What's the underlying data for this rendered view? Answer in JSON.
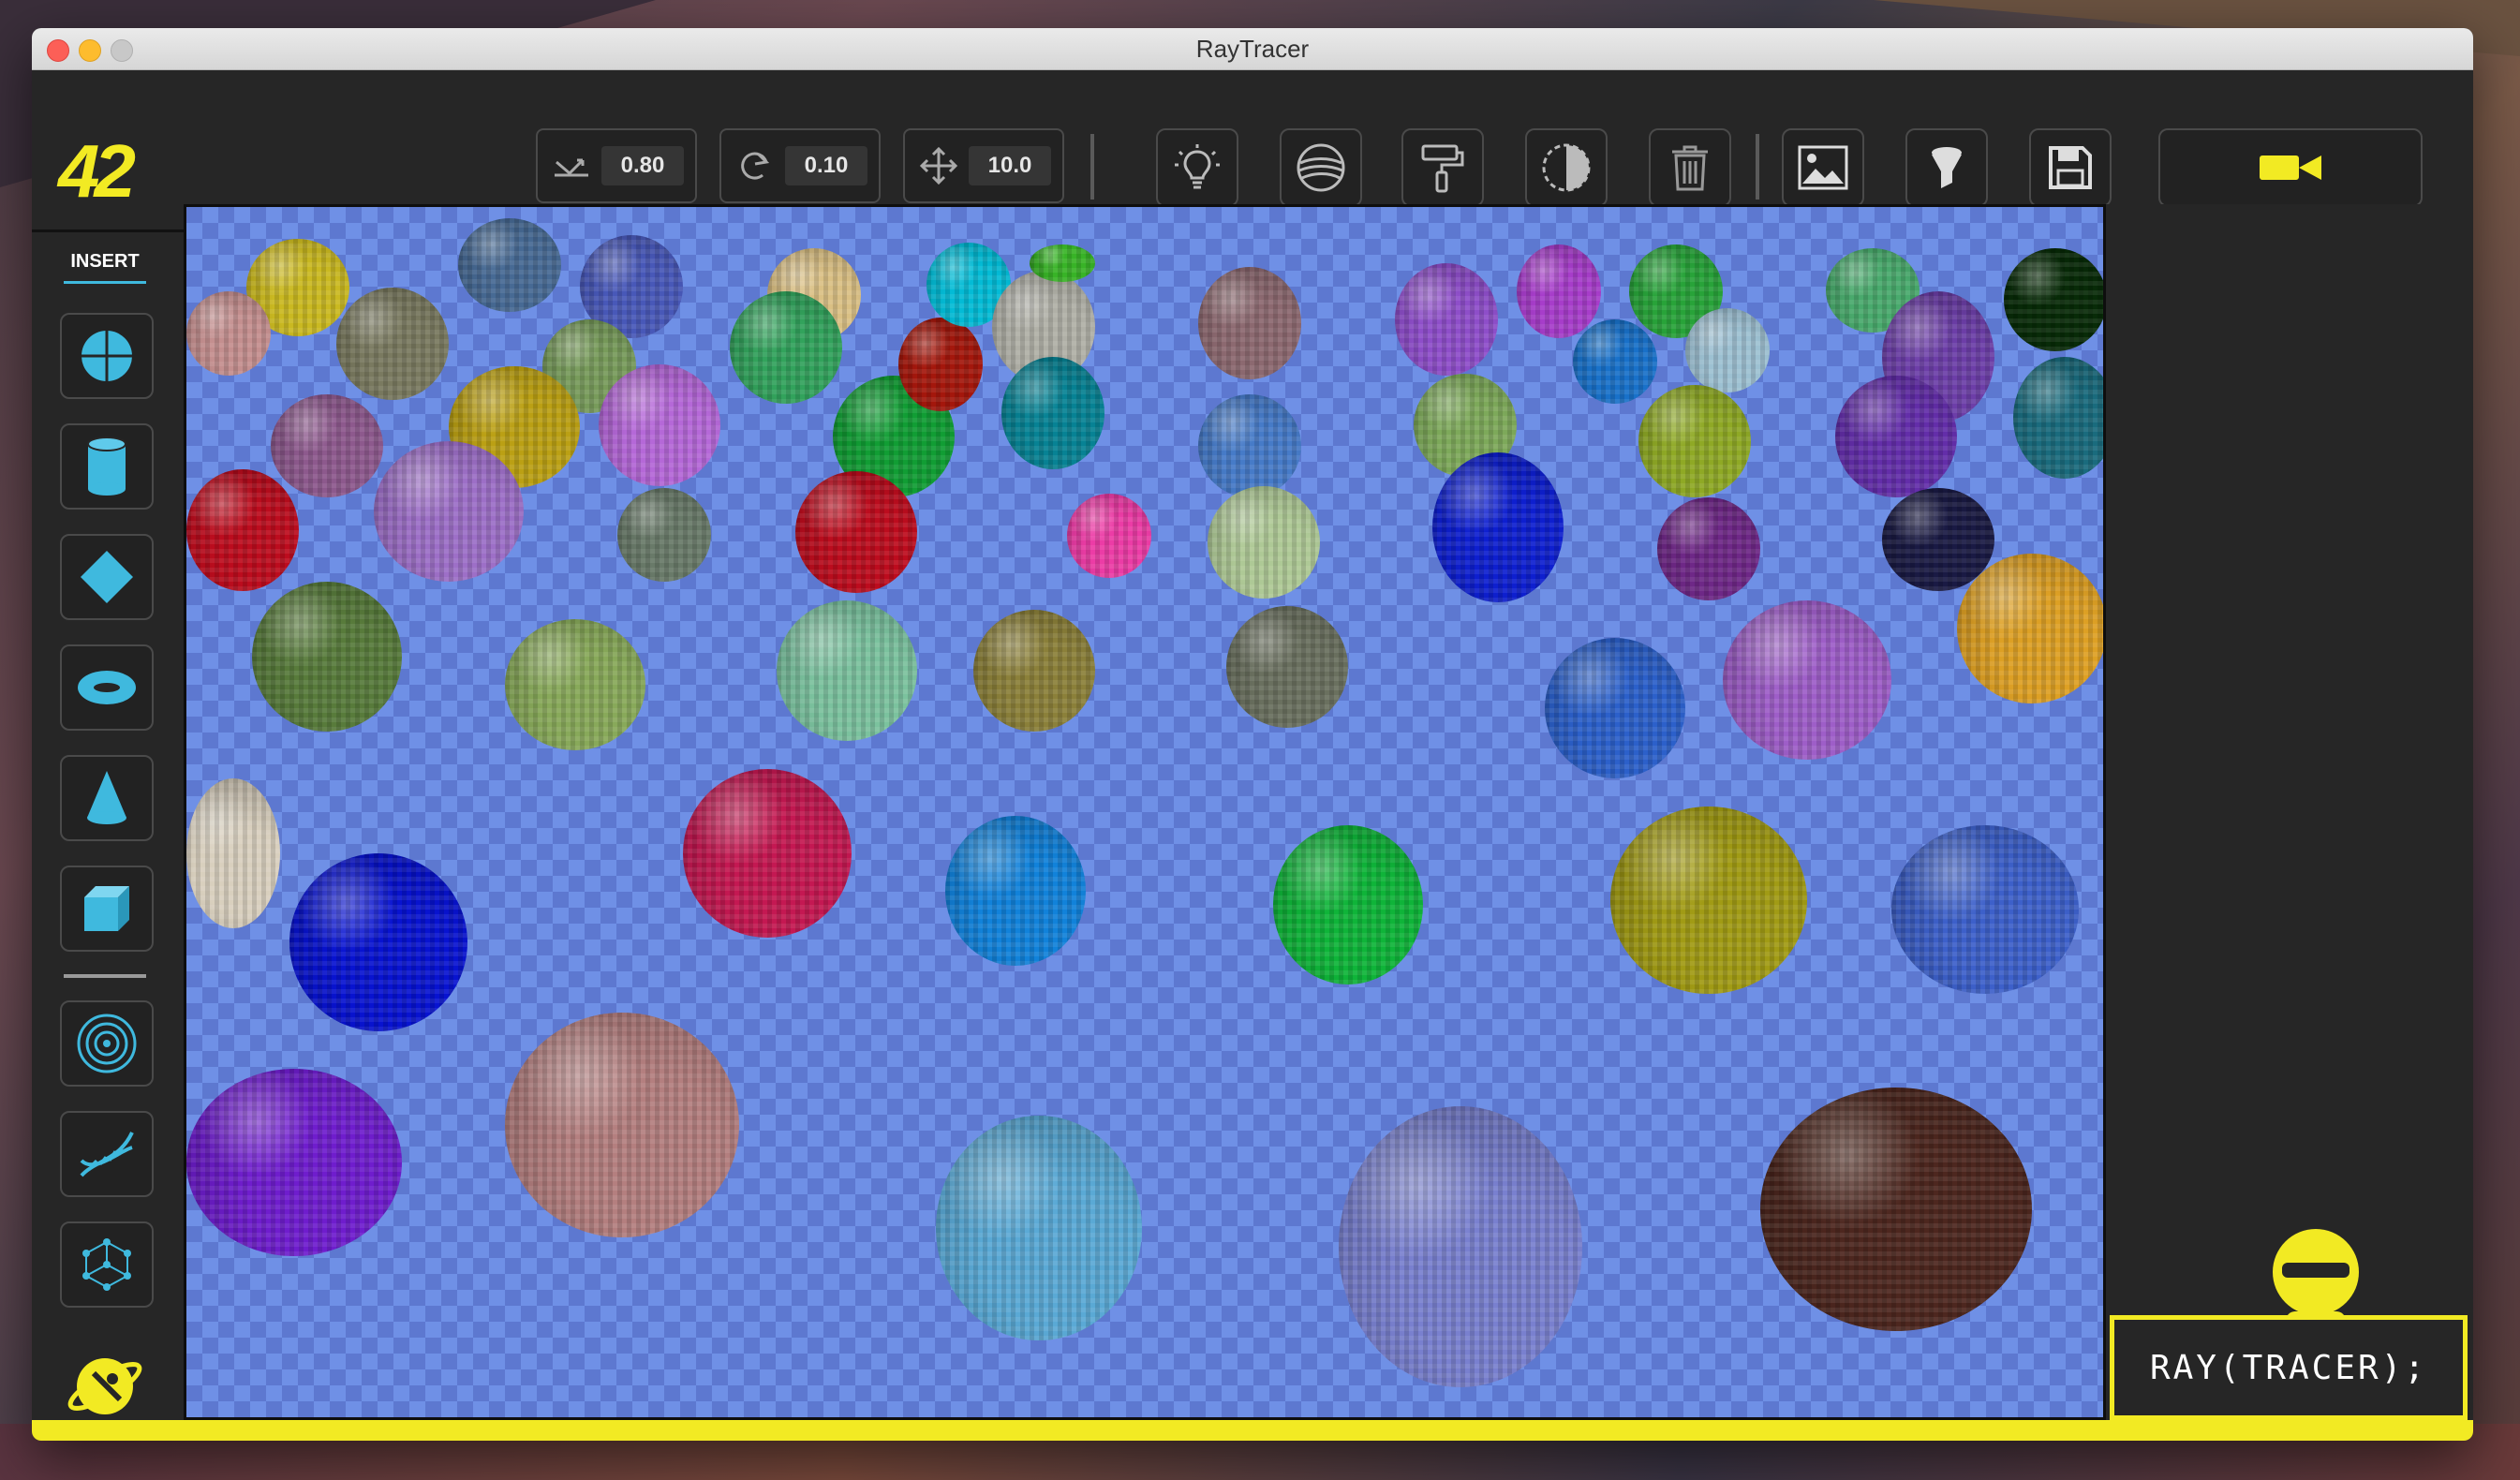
{
  "window": {
    "title": "RayTracer"
  },
  "header": {
    "logo": "42"
  },
  "toolbar": {
    "params": [
      {
        "name": "reflection",
        "icon": "reflection-angle-icon",
        "value": "0.80"
      },
      {
        "name": "rotation",
        "icon": "rotate-icon",
        "value": "0.10"
      },
      {
        "name": "translation",
        "icon": "move-arrows-icon",
        "value": "10.0"
      }
    ],
    "actions": [
      {
        "name": "light",
        "icon": "lightbulb-icon"
      },
      {
        "name": "texture",
        "icon": "texture-sphere-icon"
      },
      {
        "name": "paint",
        "icon": "paint-roller-icon"
      },
      {
        "name": "contrast",
        "icon": "contrast-icon"
      },
      {
        "name": "delete",
        "icon": "trash-icon"
      },
      {
        "name": "image",
        "icon": "image-icon"
      },
      {
        "name": "filter",
        "icon": "filter-funnel-icon"
      },
      {
        "name": "save",
        "icon": "save-disk-icon"
      }
    ],
    "camera": {
      "icon": "video-camera-icon"
    }
  },
  "sidebar": {
    "label": "INSERT",
    "items": [
      {
        "name": "sphere",
        "icon": "sphere-icon"
      },
      {
        "name": "cylinder",
        "icon": "cylinder-icon"
      },
      {
        "name": "diamond",
        "icon": "diamond-icon"
      },
      {
        "name": "torus",
        "icon": "torus-icon"
      },
      {
        "name": "cone",
        "icon": "cone-icon"
      },
      {
        "name": "cube",
        "icon": "cube-icon"
      },
      {
        "name": "rings",
        "icon": "concentric-rings-icon"
      },
      {
        "name": "dna",
        "icon": "dna-helix-icon"
      },
      {
        "name": "mesh",
        "icon": "mesh-network-icon"
      }
    ],
    "footer_icon": "rocket-planet-icon"
  },
  "brand": {
    "text": "RAY(TRACER);"
  },
  "colors": {
    "accent": "#f2ea23",
    "icon": "#3fb9de",
    "floor_a": "#5d78d0",
    "floor_b": "#6f90e6"
  }
}
